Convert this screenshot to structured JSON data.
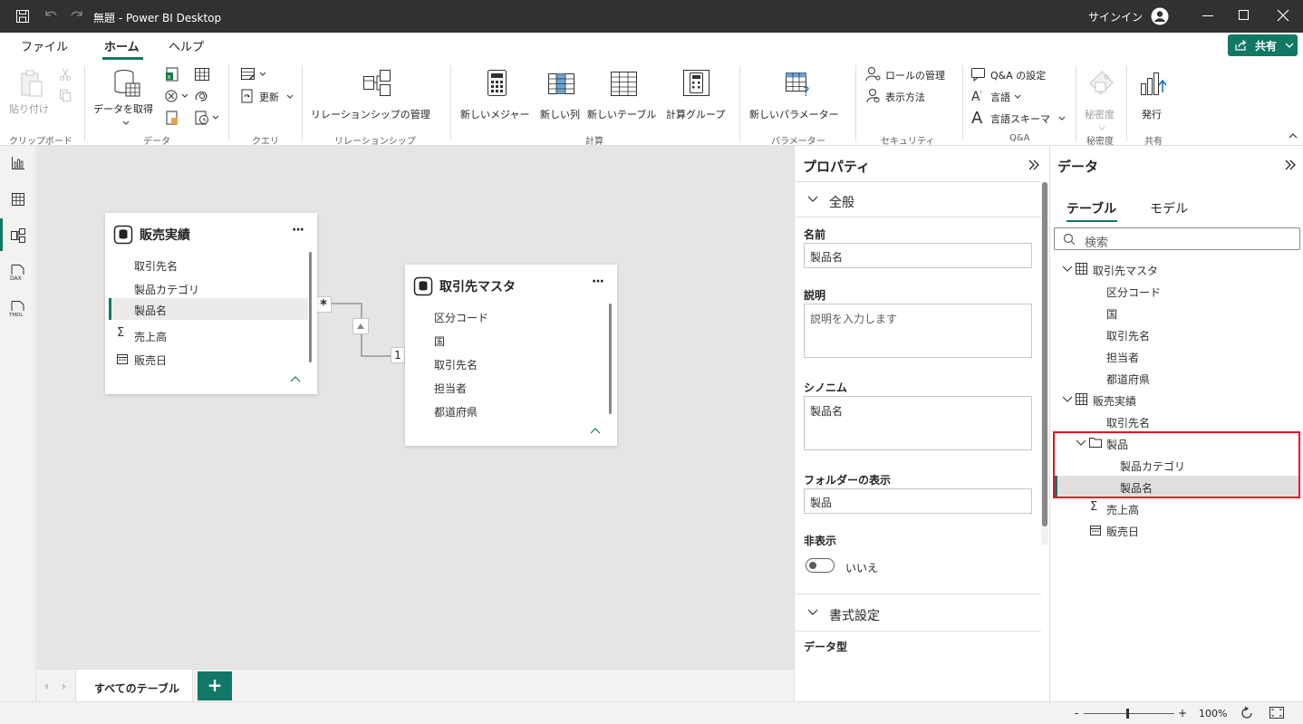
{
  "window": {
    "title": "無題 - Power BI Desktop",
    "signin": "サインイン"
  },
  "menu": {
    "file": "ファイル",
    "home": "ホーム",
    "help": "ヘルプ",
    "share": "共有"
  },
  "ribbon": {
    "paste": "貼り付け",
    "get_data": "データを取得",
    "refresh": "更新",
    "manage_relationships": "リレーションシップの管理",
    "new_measure": "新しいメジャー",
    "new_column": "新しい列",
    "new_table": "新しいテーブル",
    "calc_group": "計算グループ",
    "new_parameter": "新しいパラメーター",
    "manage_roles": "ロールの管理",
    "view_as": "表示方法",
    "qa_setup": "Q&A の設定",
    "language": "言語",
    "linguistic_schema": "言語スキーマ",
    "sensitivity": "秘密度",
    "publish": "発行",
    "groups": {
      "clipboard": "クリップボード",
      "data": "データ",
      "query": "クエリ",
      "relationships": "リレーションシップ",
      "calculations": "計算",
      "parameters": "パラメーター",
      "security": "セキュリティ",
      "qa": "Q&A",
      "sensitivity": "秘密度",
      "share": "共有"
    }
  },
  "canvas": {
    "table1": {
      "name": "販売実績",
      "fields": [
        "取引先名",
        "製品カテゴリ",
        "製品名",
        "売上高",
        "販売日"
      ]
    },
    "table2": {
      "name": "取引先マスタ",
      "fields": [
        "区分コード",
        "国",
        "取引先名",
        "担当者",
        "都道府県"
      ]
    },
    "rel_many": "*",
    "rel_one": "1",
    "more": "···"
  },
  "tabbar": {
    "active_tab": "すべてのテーブル",
    "add": "+"
  },
  "properties": {
    "title": "プロパティ",
    "general": "全般",
    "name_label": "名前",
    "name_value": "製品名",
    "desc_label": "説明",
    "desc_placeholder": "説明を入力します",
    "synonyms_label": "シノニム",
    "synonyms_value": "製品名",
    "folder_label": "フォルダーの表示",
    "folder_value": "製品",
    "hidden_label": "非表示",
    "hidden_value": "いいえ",
    "formatting": "書式設定",
    "datatype_label": "データ型"
  },
  "data_pane": {
    "title": "データ",
    "tab_tables": "テーブル",
    "tab_model": "モデル",
    "search_placeholder": "検索",
    "t1": "取引先マスタ",
    "t1_fields": [
      "区分コード",
      "国",
      "取引先名",
      "担当者",
      "都道府県"
    ],
    "t2": "販売実績",
    "t2_field": "取引先名",
    "folder": "製品",
    "folder_fields": [
      "製品カテゴリ",
      "製品名"
    ],
    "t2_sum": "売上高",
    "t2_date": "販売日"
  },
  "status": {
    "zoom": "100%",
    "minus": "-",
    "plus": "+"
  },
  "colors": {
    "accent": "#117865",
    "highlight": "#e81123"
  }
}
